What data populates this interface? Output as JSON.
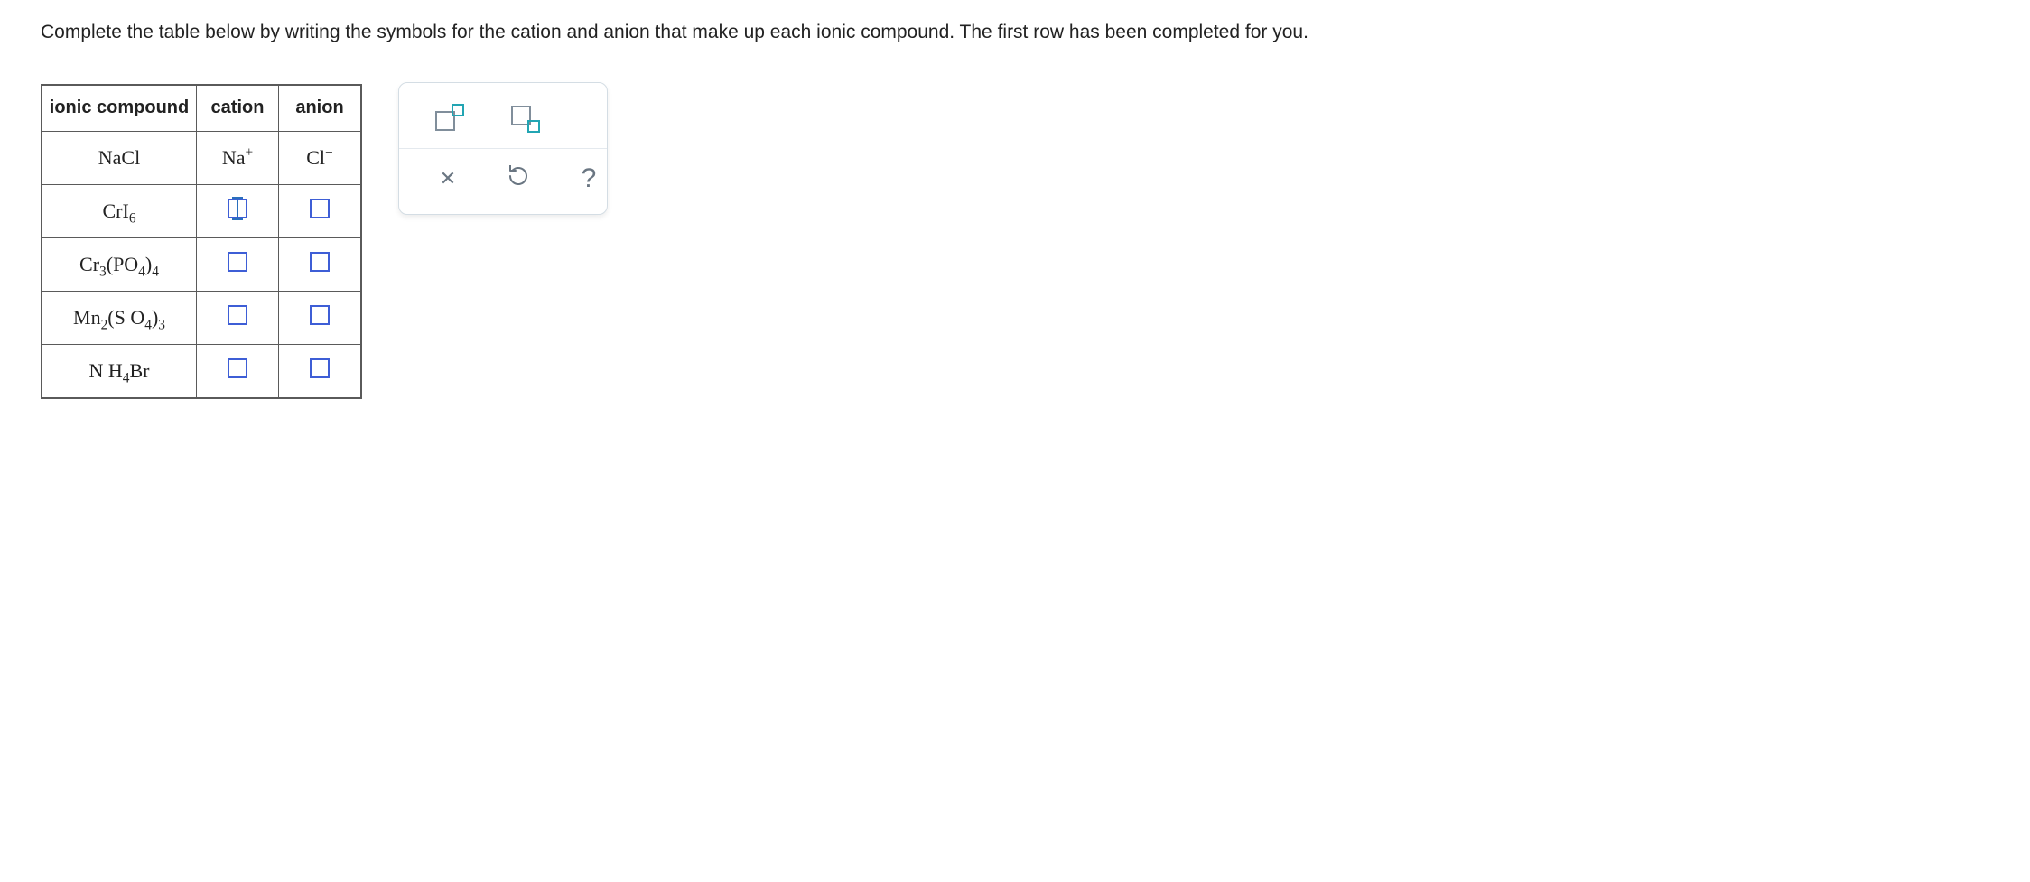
{
  "instruction": "Complete the table below by writing the symbols for the cation and anion that make up each ionic compound. The first row has been completed for you.",
  "table": {
    "headers": {
      "compound": "ionic compound",
      "cation": "cation",
      "anion": "anion"
    },
    "rows": [
      {
        "compound": {
          "parts": [
            {
              "t": "Na"
            },
            {
              "t": "Cl"
            }
          ]
        },
        "cation": {
          "parts": [
            {
              "t": "Na"
            },
            {
              "sup": "+"
            }
          ]
        },
        "anion": {
          "parts": [
            {
              "t": "Cl"
            },
            {
              "sup": "−"
            }
          ]
        },
        "editable": false
      },
      {
        "compound": {
          "parts": [
            {
              "t": "CrI"
            },
            {
              "sub": "6"
            }
          ]
        },
        "cation": {
          "input": true,
          "active": true
        },
        "anion": {
          "input": true
        },
        "editable": true
      },
      {
        "compound": {
          "parts": [
            {
              "t": "Cr"
            },
            {
              "sub": "3"
            },
            {
              "t": "(PO"
            },
            {
              "sub": "4"
            },
            {
              "t": ")"
            },
            {
              "sub": "4"
            }
          ]
        },
        "cation": {
          "input": true
        },
        "anion": {
          "input": true
        },
        "editable": true
      },
      {
        "compound": {
          "parts": [
            {
              "t": "Mn"
            },
            {
              "sub": "2"
            },
            {
              "t": "(S O"
            },
            {
              "sub": "4"
            },
            {
              "t": ")"
            },
            {
              "sub": "3"
            }
          ]
        },
        "cation": {
          "input": true
        },
        "anion": {
          "input": true
        },
        "editable": true
      },
      {
        "compound": {
          "parts": [
            {
              "t": "N H"
            },
            {
              "sub": "4"
            },
            {
              "t": "Br"
            }
          ]
        },
        "cation": {
          "input": true
        },
        "anion": {
          "input": true
        },
        "editable": true
      }
    ]
  },
  "tools": {
    "superscript": "superscript",
    "subscript": "subscript",
    "clear": "clear",
    "reset": "reset",
    "help": "?"
  }
}
